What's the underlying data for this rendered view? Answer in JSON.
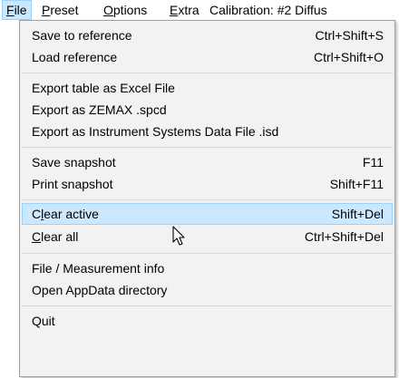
{
  "menubar": {
    "file": {
      "accel": "F",
      "rest": "ile"
    },
    "preset": {
      "accel": "P",
      "rest": "reset"
    },
    "options": {
      "accel": "O",
      "rest": "ptions"
    },
    "extra": {
      "accel": "E",
      "rest": "xtra"
    },
    "calibration": "Calibration: #2 Diffus"
  },
  "file_menu": {
    "save_reference": {
      "label": "Save to reference",
      "shortcut": "Ctrl+Shift+S"
    },
    "load_reference": {
      "label": "Load reference",
      "shortcut": "Ctrl+Shift+O"
    },
    "export_excel": {
      "label": "Export table as Excel File"
    },
    "export_zemax": {
      "label": "Export as ZEMAX .spcd"
    },
    "export_isd": {
      "label": "Export as Instrument Systems Data File .isd"
    },
    "save_snapshot": {
      "label": "Save snapshot",
      "shortcut": "F11"
    },
    "print_snapshot": {
      "label": "Print snapshot",
      "shortcut": "Shift+F11"
    },
    "clear_active": {
      "pre": "C",
      "accel": "l",
      "post": "ear active",
      "shortcut": "Shift+Del"
    },
    "clear_all": {
      "accel": "C",
      "post": "lear all",
      "shortcut": "Ctrl+Shift+Del"
    },
    "file_info": {
      "label": "File / Measurement info"
    },
    "open_appdata": {
      "label": "Open AppData directory"
    },
    "quit": {
      "label": "Quit"
    }
  },
  "colors": {
    "highlight_bg": "#cce8ff",
    "highlight_border": "#99d1ff",
    "menu_bg": "#f2f2f2"
  },
  "icons": {
    "pointer": "mouse-pointer-icon"
  }
}
